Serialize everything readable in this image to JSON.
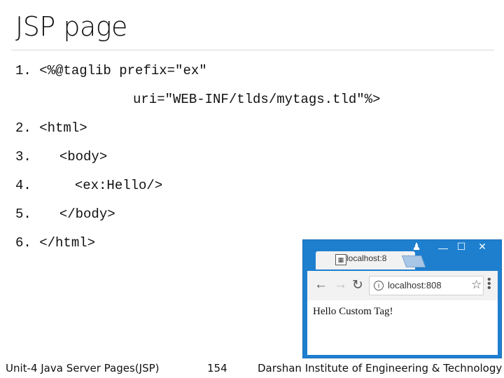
{
  "slide": {
    "title": "JSP page",
    "code_lines": [
      {
        "num": "1.",
        "text": "<%@taglib prefix=\"ex\""
      },
      {
        "num": "",
        "text": "uri=\"WEB-INF/tlds/mytags.tld\"%>"
      },
      {
        "num": "2.",
        "text": "<html>"
      },
      {
        "num": "3.",
        "text": "<body>"
      },
      {
        "num": "4.",
        "text": "<ex:Hello/>"
      },
      {
        "num": "5.",
        "text": "</body>"
      },
      {
        "num": "6.",
        "text": "</html>"
      }
    ]
  },
  "browser": {
    "tab_title": "localhost:8",
    "address": "localhost:808",
    "page_text": "Hello Custom Tag!",
    "window_buttons": [
      "user-icon",
      "minimize-icon",
      "maximize-icon",
      "close-icon"
    ],
    "accent_color": "#1e7fcf"
  },
  "footer": {
    "course": "Unit-4 Java Server Pages(JSP)",
    "page_number": "154",
    "institute": "Darshan Institute of Engineering & Technology"
  }
}
